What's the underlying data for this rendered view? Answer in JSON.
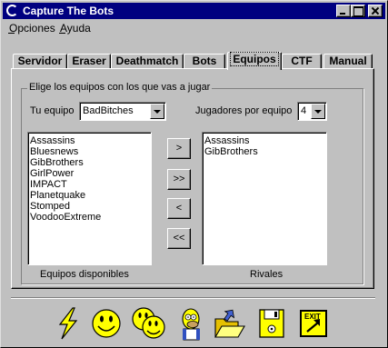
{
  "window": {
    "title": "Capture The Bots"
  },
  "menu": {
    "items": [
      {
        "label": "Opciones"
      },
      {
        "label": "Ayuda"
      }
    ]
  },
  "tabs": [
    {
      "label": "Servidor"
    },
    {
      "label": "Eraser"
    },
    {
      "label": "Deathmatch"
    },
    {
      "label": "Bots"
    },
    {
      "label": "Equipos",
      "active": true
    },
    {
      "label": "CTF"
    },
    {
      "label": "Manual"
    }
  ],
  "equipos": {
    "group_label": "Elige los equipos con los que vas a jugar",
    "team_label": "Tu equipo",
    "team_value": "BadBitches",
    "players_label": "Jugadores por equipo",
    "players_value": "4",
    "available_caption": "Equipos disponibles",
    "rivals_caption": "Rivales",
    "available_teams": [
      "Assassins",
      "Bluesnews",
      "GibBrothers",
      "GirlPower",
      "IMPACT",
      "Planetquake",
      "Stomped",
      "VoodooExtreme"
    ],
    "rival_teams": [
      "Assassins",
      "GibBrothers"
    ],
    "buttons": {
      "add": ">",
      "add_all": ">>",
      "remove": "<",
      "remove_all": "<<"
    }
  },
  "toolbar": {
    "icons": [
      "lightning-icon",
      "smiley-icon",
      "double-smiley-icon",
      "homer-icon",
      "open-folder-icon",
      "save-disk-icon",
      "exit-icon"
    ],
    "exit_label": "EXIT"
  },
  "colors": {
    "titlebar": "#000080",
    "face": "#c0c0c0",
    "yellow": "#ffff00"
  }
}
